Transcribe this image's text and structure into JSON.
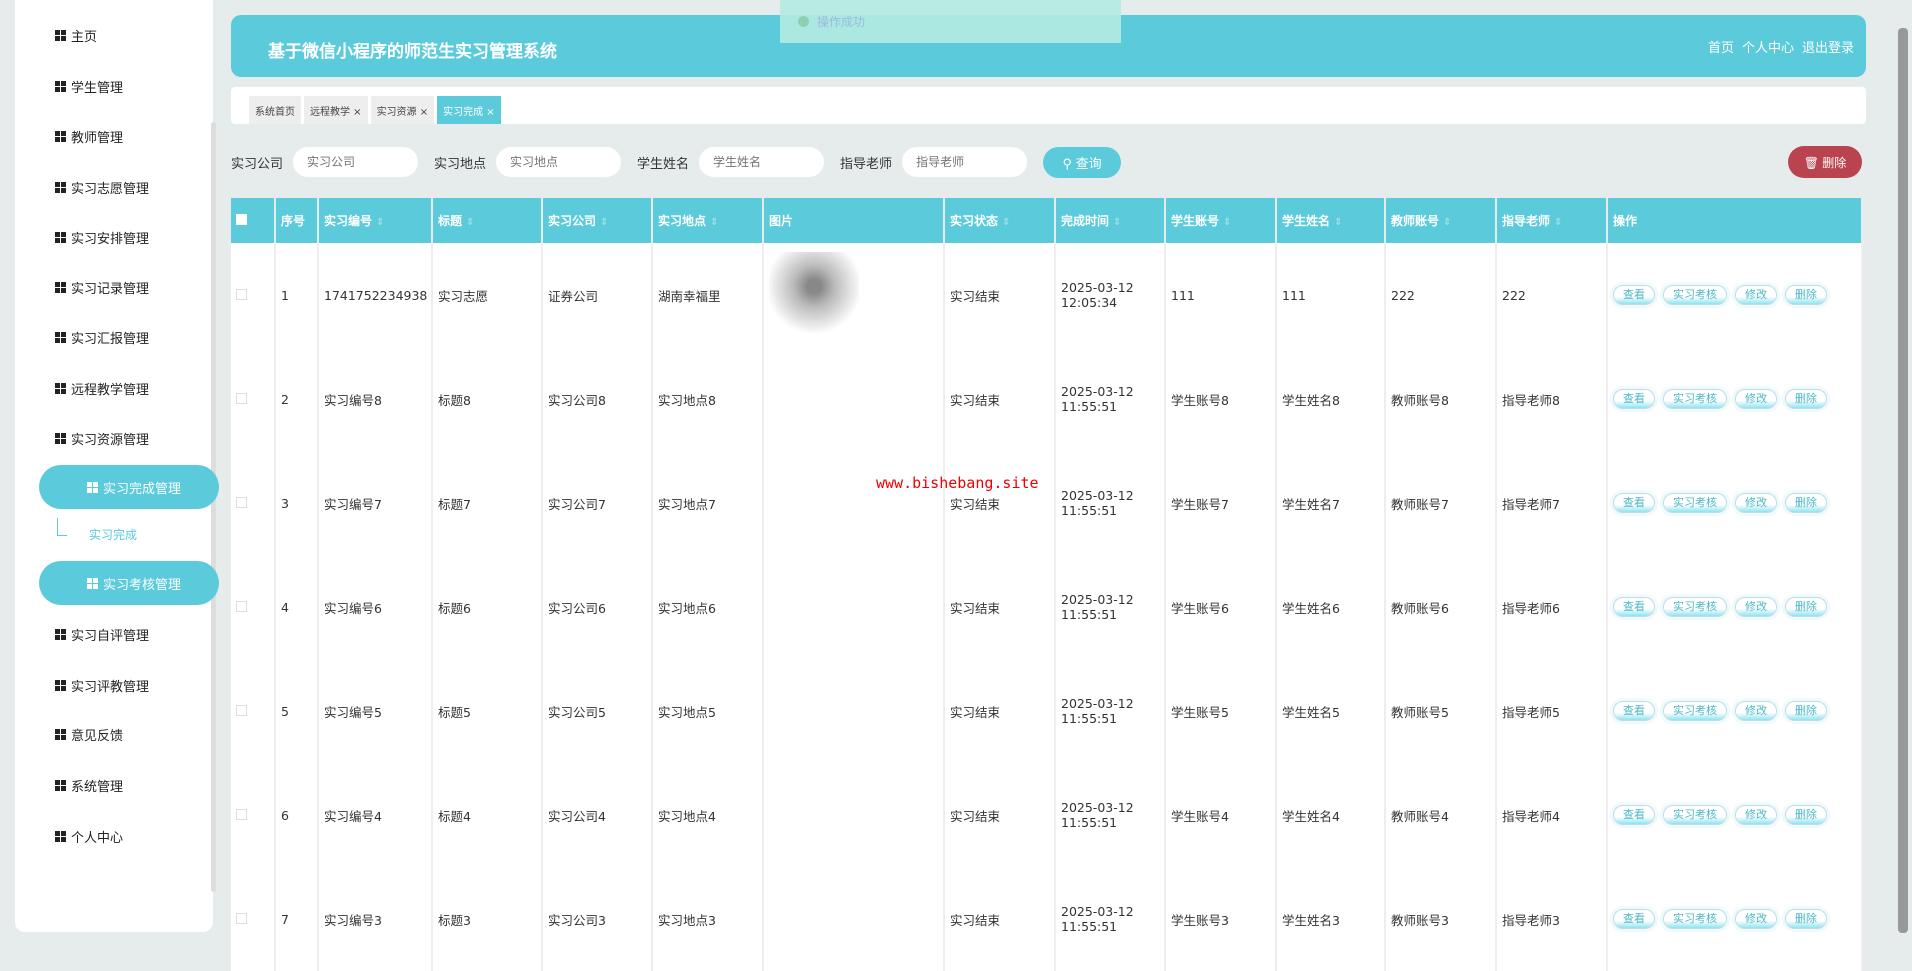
{
  "toast": "操作成功",
  "header": {
    "title": "基于微信小程序的师范生实习管理系统",
    "links": [
      "首页",
      "个人中心",
      "退出登录"
    ]
  },
  "sidebar": {
    "items": [
      "主页",
      "学生管理",
      "教师管理",
      "实习志愿管理",
      "实习安排管理",
      "实习记录管理",
      "实习汇报管理",
      "远程教学管理",
      "实习资源管理",
      "实习完成管理",
      "实习考核管理",
      "实习自评管理",
      "实习评教管理",
      "意见反馈",
      "系统管理",
      "个人中心"
    ],
    "sub": "实习完成"
  },
  "tabs": [
    "系统首页",
    "远程教学 ×",
    "实习资源 ×",
    "实习完成 ×"
  ],
  "search": {
    "fields": [
      {
        "label": "实习公司",
        "placeholder": "实习公司"
      },
      {
        "label": "实习地点",
        "placeholder": "实习地点"
      },
      {
        "label": "学生姓名",
        "placeholder": "学生姓名"
      },
      {
        "label": "指导老师",
        "placeholder": "指导老师"
      }
    ],
    "query": "查询",
    "delete": "删除"
  },
  "table": {
    "headers": [
      "序号",
      "实习编号",
      "标题",
      "实习公司",
      "实习地点",
      "图片",
      "实习状态",
      "完成时间",
      "学生账号",
      "学生姓名",
      "教师账号",
      "指导老师",
      "操作"
    ],
    "rows": [
      [
        "1",
        "1741752234938",
        "实习志愿",
        "证券公司",
        "湖南幸福里",
        "",
        "实习结束",
        "2025-03-12 12:05:34",
        "111",
        "111",
        "222",
        "222"
      ],
      [
        "2",
        "实习编号8",
        "标题8",
        "实习公司8",
        "实习地点8",
        "",
        "实习结束",
        "2025-03-12 11:55:51",
        "学生账号8",
        "学生姓名8",
        "教师账号8",
        "指导老师8"
      ],
      [
        "3",
        "实习编号7",
        "标题7",
        "实习公司7",
        "实习地点7",
        "",
        "实习结束",
        "2025-03-12 11:55:51",
        "学生账号7",
        "学生姓名7",
        "教师账号7",
        "指导老师7"
      ],
      [
        "4",
        "实习编号6",
        "标题6",
        "实习公司6",
        "实习地点6",
        "",
        "实习结束",
        "2025-03-12 11:55:51",
        "学生账号6",
        "学生姓名6",
        "教师账号6",
        "指导老师6"
      ],
      [
        "5",
        "实习编号5",
        "标题5",
        "实习公司5",
        "实习地点5",
        "",
        "实习结束",
        "2025-03-12 11:55:51",
        "学生账号5",
        "学生姓名5",
        "教师账号5",
        "指导老师5"
      ],
      [
        "6",
        "实习编号4",
        "标题4",
        "实习公司4",
        "实习地点4",
        "",
        "实习结束",
        "2025-03-12 11:55:51",
        "学生账号4",
        "学生姓名4",
        "教师账号4",
        "指导老师4"
      ],
      [
        "7",
        "实习编号3",
        "标题3",
        "实习公司3",
        "实习地点3",
        "",
        "实习结束",
        "2025-03-12 11:55:51",
        "学生账号3",
        "学生姓名3",
        "教师账号3",
        "指导老师3"
      ]
    ],
    "actions": [
      "查看",
      "实习考核",
      "修改",
      "删除"
    ]
  },
  "watermark": "www.bishebang.site"
}
